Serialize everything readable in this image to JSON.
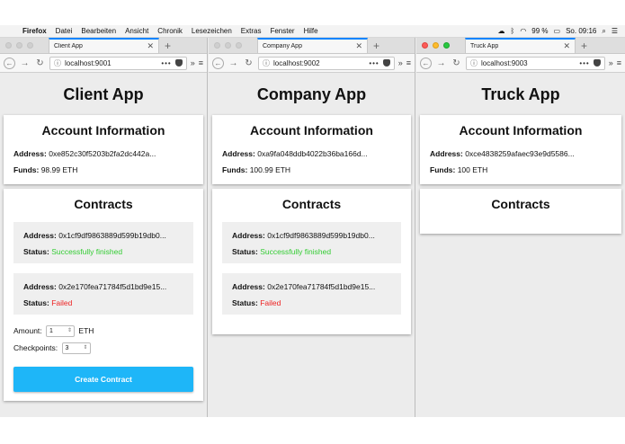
{
  "menubar": {
    "app": "Firefox",
    "items": [
      "Datei",
      "Bearbeiten",
      "Ansicht",
      "Chronik",
      "Lesezeichen",
      "Extras",
      "Fenster",
      "Hilfe"
    ],
    "battery": "99 %",
    "clock": "So. 09:16"
  },
  "windows": [
    {
      "tab_title": "Client App",
      "url": "localhost:9001",
      "app_title": "Client App",
      "account": {
        "heading": "Account Information",
        "address_label": "Address:",
        "address": "0xe852c30f5203b2fa2dc442a...",
        "funds_label": "Funds:",
        "funds": "98.99 ETH"
      },
      "contracts": {
        "heading": "Contracts",
        "items": [
          {
            "address_label": "Address:",
            "address": "0x1cf9df9863889d599b19db0...",
            "status_label": "Status:",
            "status": "Successfully finished"
          },
          {
            "address_label": "Address:",
            "address": "0x2e170fea71784f5d1bd9e15...",
            "status_label": "Status:",
            "status": "Failed"
          }
        ],
        "amount_label": "Amount:",
        "amount_value": "1",
        "amount_unit": "ETH",
        "checkpoints_label": "Checkpoints:",
        "checkpoints_value": "3",
        "create_label": "Create Contract"
      }
    },
    {
      "tab_title": "Company App",
      "url": "localhost:9002",
      "app_title": "Company App",
      "account": {
        "heading": "Account Information",
        "address_label": "Address:",
        "address": "0xa9fa048ddb4022b36ba166d...",
        "funds_label": "Funds:",
        "funds": "100.99 ETH"
      },
      "contracts": {
        "heading": "Contracts",
        "items": [
          {
            "address_label": "Address:",
            "address": "0x1cf9df9863889d599b19db0...",
            "status_label": "Status:",
            "status": "Successfully finished"
          },
          {
            "address_label": "Address:",
            "address": "0x2e170fea71784f5d1bd9e15...",
            "status_label": "Status:",
            "status": "Failed"
          }
        ]
      }
    },
    {
      "tab_title": "Truck App",
      "url": "localhost:9003",
      "app_title": "Truck App",
      "account": {
        "heading": "Account Information",
        "address_label": "Address:",
        "address": "0xce4838259afaec93e9d5586...",
        "funds_label": "Funds:",
        "funds": "100 ETH"
      },
      "contracts": {
        "heading": "Contracts"
      }
    }
  ],
  "colors": {
    "status_success": "#33cc33",
    "status_failed": "#ee2222",
    "create_button": "#1eb6f8",
    "active_tab_accent": "#0a84ff"
  },
  "icons": {
    "back": "arrow-left-icon",
    "forward": "arrow-right-icon",
    "reload": "reload-icon",
    "info": "info-icon",
    "page_actions": "more-dots-icon",
    "pocket": "pocket-icon",
    "overflow": "overflow-chevron-icon",
    "menu": "hamburger-menu-icon",
    "tab_close": "close-icon",
    "new_tab": "plus-icon"
  }
}
